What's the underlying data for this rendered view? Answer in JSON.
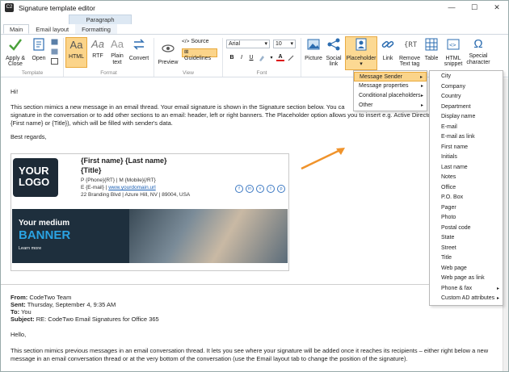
{
  "window": {
    "title": "Signature template editor",
    "controls": {
      "minimize": "—",
      "maximize": "☐",
      "close": "✕"
    }
  },
  "ribbon": {
    "context_label": "Paragraph",
    "tabs": [
      "Main",
      "Email layout",
      "Formatting"
    ],
    "groups": {
      "template": {
        "label": "Template",
        "apply_close": "Apply & Close",
        "open": "Open"
      },
      "format": {
        "label": "Format",
        "html": "HTML",
        "rtf": "RTF",
        "plain": "Plain text",
        "convert": "Convert",
        "aa": "Aa"
      },
      "view": {
        "label": "View",
        "preview": "Preview",
        "source": "Source",
        "guidelines": "Guidelines"
      },
      "font": {
        "label": "Font",
        "family": "Arial",
        "size": "10",
        "bold": "B",
        "italic": "I",
        "underline": "U",
        "dropdown": "▾",
        "font_color": "A"
      },
      "insert": {
        "picture": "Picture",
        "social_link": "Social link",
        "placeholder": "Placeholder",
        "link": "Link",
        "remove_text_tag": "Remove Text tag",
        "table": "Table",
        "html_snippet": "HTML snippet",
        "special_character": "Special character"
      }
    }
  },
  "email": {
    "greeting": "Hi!",
    "para1_line1": "This section mimics a new message in an email thread. Your email signature is shown in the Signature section below. You ca",
    "para1_line2": "signature in the conversation or to add other sections to an email: header, left or right banners. The Placeholder option allows you to insert e.g. Active Directo",
    "para1_line3": "{First name} or {Title}), which will be filled with sender's data.",
    "regards": "Best regards,",
    "signature": {
      "logo_line1": "YOUR",
      "logo_line2": "LOGO",
      "name": "{First name} {Last name}",
      "title": "{Title}",
      "phone": "P {Phone}{RT} | M {Mobile}{/RT}",
      "email_prefix": "E {E-mail} | ",
      "website": "www.yourdomain.url",
      "address": "22 Branding Blvd | Azure Hill, NV | 89004, USA",
      "social": [
        "f",
        "in",
        "v",
        "t",
        "p"
      ],
      "banner_line1": "Your medium",
      "banner_line2": "BANNER",
      "banner_line3": "Learn more"
    },
    "previous": {
      "from_label": "From:",
      "from": "CodeTwo Team",
      "sent_label": "Sent:",
      "sent": "Thursday, September 4, 9:35 AM",
      "to_label": "To:",
      "to": "You",
      "subject_label": "Subject:",
      "subject": "RE: CodeTwo Email Signatures for Office 365",
      "greeting": "Hello,",
      "para_line1": "This section mimics previous messages in an email conversation thread. It lets you see where your signature will be added once it reaches its recipients – either right below a new",
      "para_line2": "message in an email conversation thread or at the very bottom of the conversation (use the Email layout tab to change the position of the signature)."
    }
  },
  "menus": {
    "placeholder": [
      "Message Sender",
      "Message properties",
      "Conditional placeholders",
      "Other"
    ],
    "sender_fields": [
      "City",
      "Company",
      "Country",
      "Department",
      "Display name",
      "E-mail",
      "E-mail as link",
      "First name",
      "Initials",
      "Last name",
      "Notes",
      "Office",
      "P.O. Box",
      "Pager",
      "Photo",
      "Postal code",
      "State",
      "Street",
      "Title",
      "Web page",
      "Web page as link",
      "Phone & fax",
      "Custom AD attributes"
    ],
    "submenu_arrow": "▸"
  },
  "colors": {
    "highlight": "#fbd48a",
    "arrow": "#f0932b",
    "link": "#1a5fb4",
    "accent": "#2aa3e3"
  }
}
